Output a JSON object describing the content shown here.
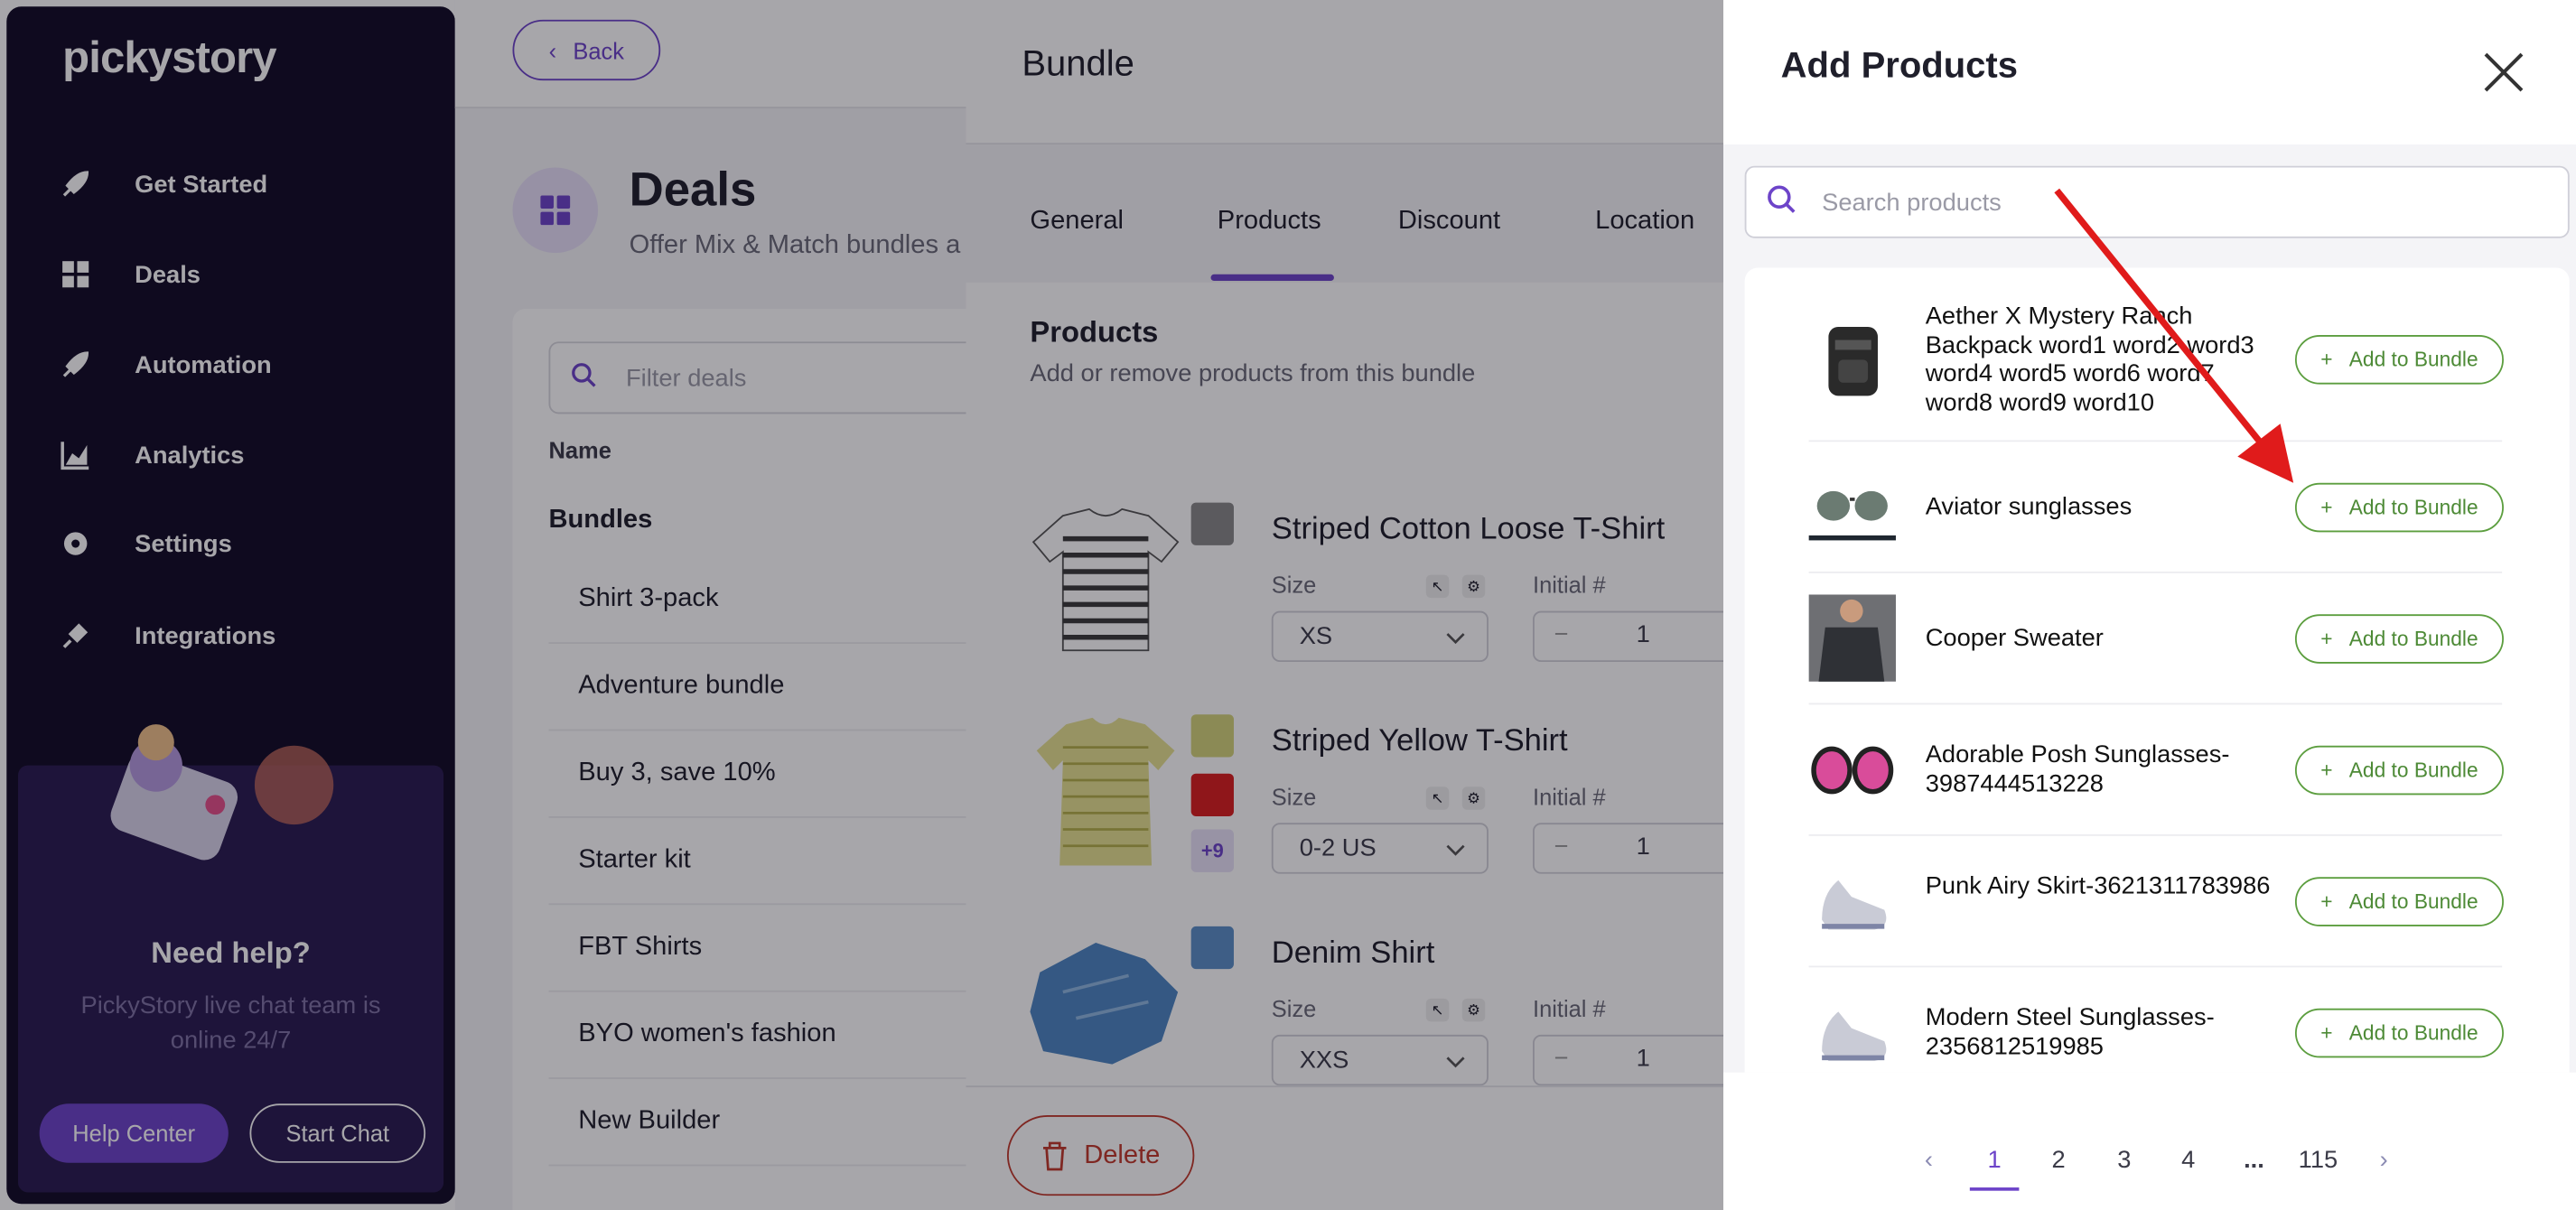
{
  "sidebar": {
    "logo": "pickystory",
    "items": [
      {
        "label": "Get Started",
        "icon": "rocket-icon"
      },
      {
        "label": "Deals",
        "icon": "grid-icon"
      },
      {
        "label": "Automation",
        "icon": "rocket-icon"
      },
      {
        "label": "Analytics",
        "icon": "chart-icon"
      },
      {
        "label": "Settings",
        "icon": "gear-icon"
      },
      {
        "label": "Integrations",
        "icon": "plug-icon"
      }
    ],
    "help": {
      "title": "Need help?",
      "subtitle": "PickyStory live chat team is online 24/7",
      "help_center": "Help Center",
      "start_chat": "Start Chat"
    }
  },
  "main": {
    "back_label": "Back",
    "title": "Deals",
    "subtitle": "Offer Mix & Match bundles a",
    "filter_placeholder": "Filter deals",
    "column_name": "Name",
    "group_label": "Bundles",
    "deals": [
      "Shirt 3-pack",
      "Adventure bundle",
      "Buy 3, save 10%",
      "Starter kit",
      "FBT Shirts",
      "BYO women's fashion",
      "New Builder"
    ]
  },
  "bundle": {
    "title": "Bundle",
    "tabs": [
      "General",
      "Products",
      "Discount",
      "Location"
    ],
    "active_tab": "Products",
    "products_title": "Products",
    "products_subtitle": "Add or remove products from this bundle",
    "size_label": "Size",
    "initial_label": "Initial #",
    "products": [
      {
        "name": "Striped Cotton Loose T-Shirt",
        "size": "XS",
        "initial": "1"
      },
      {
        "name": "Striped Yellow T-Shirt",
        "size": "0-2 US",
        "initial": "1",
        "more": "+9"
      },
      {
        "name": "Denim Shirt",
        "size": "XXS",
        "initial": "1"
      }
    ],
    "delete_label": "Delete"
  },
  "add_products": {
    "title": "Add Products",
    "search_placeholder": "Search products",
    "add_label": "Add to Bundle",
    "items": [
      {
        "name": "Aether X Mystery Ranch Backpack word1 word2 word3 word4 word5 word6 word7 word8 word9 word10"
      },
      {
        "name": "Aviator sunglasses"
      },
      {
        "name": "Cooper Sweater"
      },
      {
        "name": "Adorable Posh Sunglasses-3987444513228"
      },
      {
        "name": "Punk Airy Skirt-3621311783986"
      },
      {
        "name": "Modern Steel Sunglasses-2356812519985"
      }
    ],
    "pagination": [
      "1",
      "2",
      "3",
      "4",
      "...",
      "115"
    ],
    "current_page": "1"
  },
  "colors": {
    "brand": "#6d44c9",
    "sidebar_bg": "#120b26",
    "add_green": "#4d8a36",
    "delete_red": "#c0392b",
    "annotation_arrow": "#e01b1b"
  }
}
